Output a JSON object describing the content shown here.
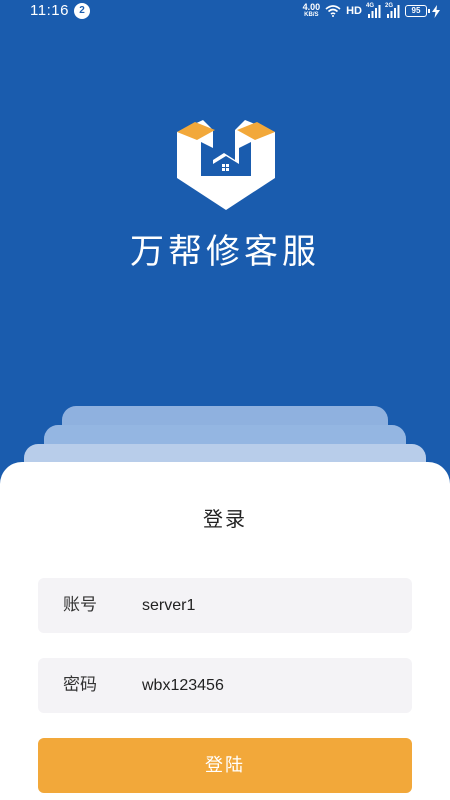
{
  "status_bar": {
    "time": "11:16",
    "notification_count": "2",
    "net_speed_value": "4.00",
    "net_speed_unit": "KB/S",
    "hd_label": "HD",
    "sim1_tag": "4G",
    "sim2_tag": "2G",
    "battery_level": "95"
  },
  "app": {
    "title": "万帮修客服"
  },
  "login": {
    "heading": "登录",
    "account_label": "账号",
    "account_value": "server1",
    "password_label": "密码",
    "password_value": "wbx123456",
    "submit_label": "登陆"
  },
  "colors": {
    "background": "#1a5cae",
    "accent": "#f2a83a",
    "field_background": "#f4f3f6"
  }
}
